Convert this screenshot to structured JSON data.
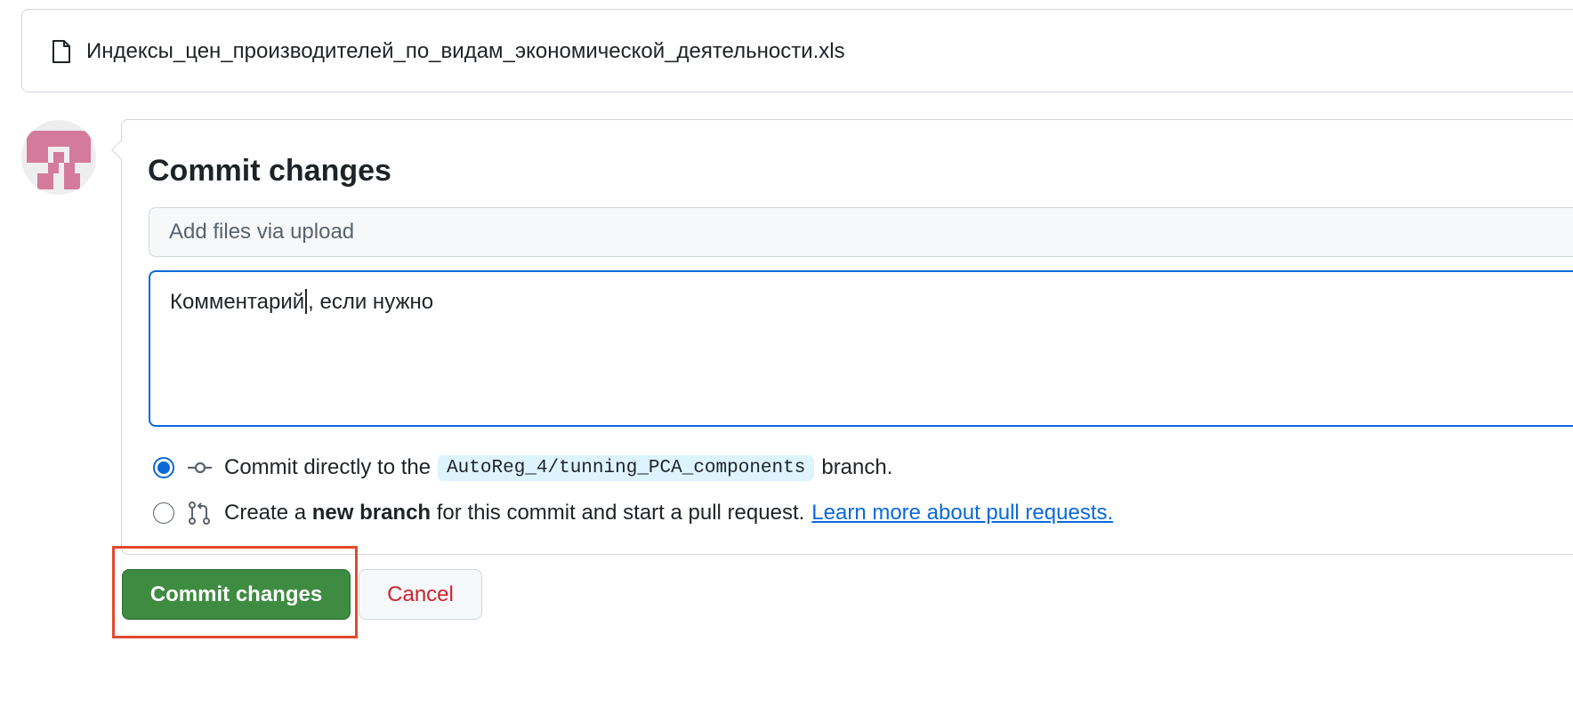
{
  "file": {
    "icon": "file-icon",
    "name": "Индексы_цен_производителей_по_видам_экономической_деятельности.xls"
  },
  "avatar": {
    "icon": "identicon-avatar",
    "color": "#d47a9a"
  },
  "commit": {
    "title": "Commit changes",
    "summary_placeholder": "Add files via upload",
    "summary_value": "",
    "description_before_cursor": "Комментарий",
    "description_after_cursor": ", если нужно"
  },
  "options": {
    "direct": {
      "selected": true,
      "icon": "git-commit-icon",
      "text_before": "Commit directly to the",
      "branch": "AutoReg_4/tunning_PCA_components",
      "text_after": "branch."
    },
    "new_branch": {
      "selected": false,
      "icon": "git-pull-request-icon",
      "text_before": "Create a",
      "bold": "new branch",
      "text_after": "for this commit and start a pull request.",
      "link": "Learn more about pull requests."
    }
  },
  "buttons": {
    "commit": "Commit changes",
    "cancel": "Cancel"
  },
  "colors": {
    "accent": "#0969da",
    "commit_button": "#3e8b42",
    "cancel_text": "#cf222e",
    "highlight": "#e24a2c"
  }
}
